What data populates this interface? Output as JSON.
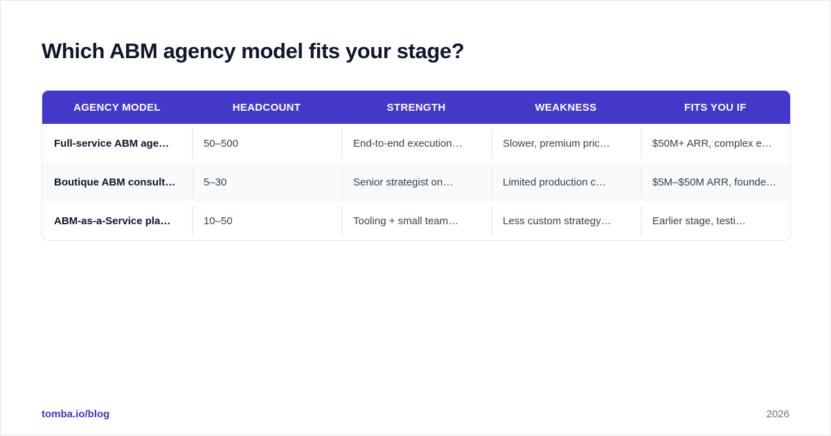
{
  "page": {
    "title": "Which ABM agency model fits your stage?"
  },
  "table": {
    "headers": [
      "AGENCY MODEL",
      "HEADCOUNT",
      "STRENGTH",
      "WEAKNESS",
      "FITS YOU IF"
    ],
    "rows": [
      {
        "model": "Full-service ABM age…",
        "headcount": "50–500",
        "strength": "End-to-end execution…",
        "weakness": "Slower, premium pric…",
        "fits": "$50M+ ARR, complex e…"
      },
      {
        "model": "Boutique ABM consult…",
        "headcount": "5–30",
        "strength": "Senior strategist on…",
        "weakness": "Limited production c…",
        "fits": "$5M–$50M ARR, founde…"
      },
      {
        "model": "ABM-as-a-Service pla…",
        "headcount": "10–50",
        "strength": "Tooling + small team…",
        "weakness": "Less custom strategy…",
        "fits": "Earlier stage, testi…"
      }
    ]
  },
  "footer": {
    "source": "tomba.io/blog",
    "year": "2026"
  },
  "colors": {
    "accent": "#4338ca",
    "title": "#0f172a",
    "row_alt": "#f8fafc",
    "muted": "#6b7280"
  }
}
